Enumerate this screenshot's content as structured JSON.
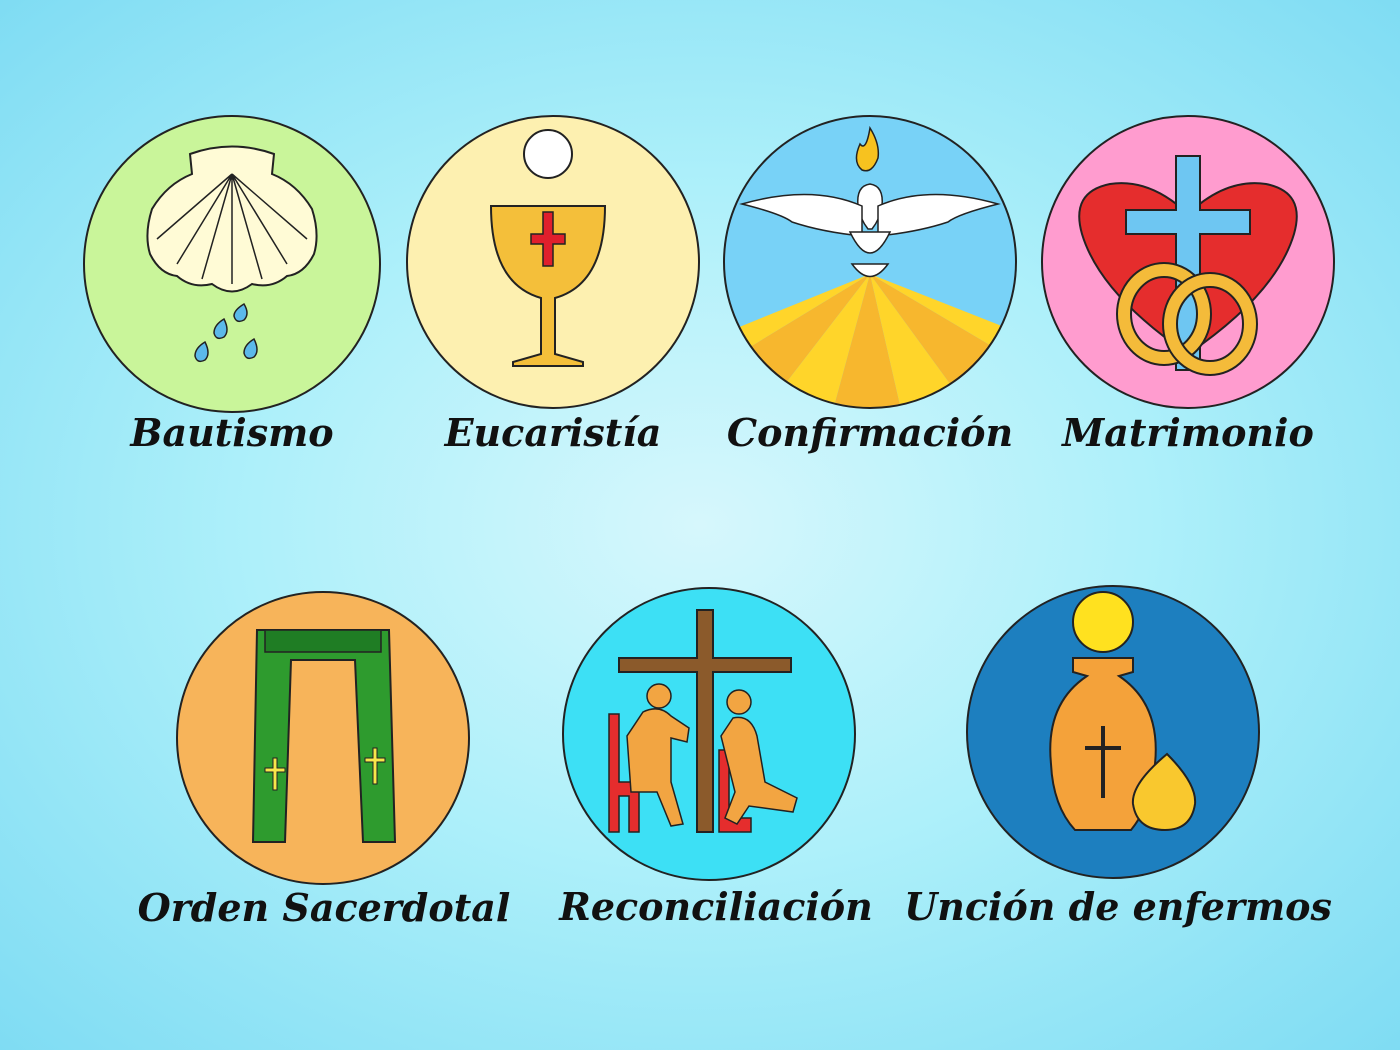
{
  "sacraments": [
    {
      "label": "Bautismo",
      "icon": "shell-water-icon",
      "bg": "#c9f59a"
    },
    {
      "label": "Eucaristía",
      "icon": "chalice-host-icon",
      "bg": "#fdf0b0"
    },
    {
      "label": "Confirmación",
      "icon": "dove-flame-icon",
      "bg": "#6fcdf5"
    },
    {
      "label": "Matrimonio",
      "icon": "heart-cross-rings-icon",
      "bg": "#ff9ccf"
    },
    {
      "label": "Orden Sacerdotal",
      "icon": "stole-icon",
      "bg": "#f7b45a"
    },
    {
      "label": "Reconciliación",
      "icon": "cross-confession-icon",
      "bg": "#3de0f5"
    },
    {
      "label": "Unción de enfermos",
      "icon": "oil-jar-host-icon",
      "bg": "#1d7fbf"
    }
  ]
}
